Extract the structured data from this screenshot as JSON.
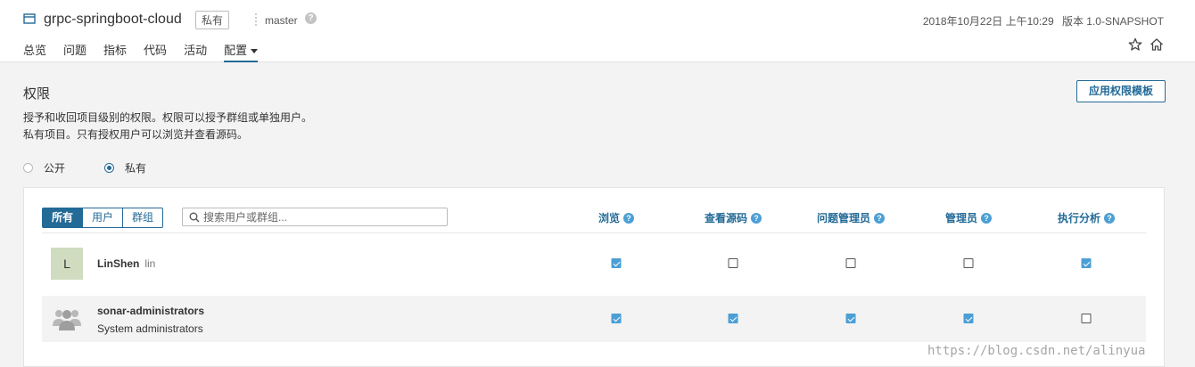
{
  "header": {
    "project_name": "grpc-springboot-cloud",
    "visibility_badge": "私有",
    "branch": "master",
    "date": "2018年10月22日 上午10:29",
    "version": "版本 1.0-SNAPSHOT"
  },
  "nav": {
    "items": [
      "总览",
      "问题",
      "指标",
      "代码",
      "活动",
      "配置"
    ],
    "active": "配置"
  },
  "page": {
    "title": "权限",
    "desc1": "授予和收回项目级别的权限。权限可以授予群组或单独用户。",
    "desc2": "私有项目。只有授权用户可以浏览并查看源码。",
    "apply_template_label": "应用权限模板",
    "visibility": {
      "public_label": "公开",
      "private_label": "私有",
      "selected": "私有"
    }
  },
  "filter": {
    "tabs": [
      "所有",
      "用户",
      "群组"
    ],
    "selected": "所有",
    "search_placeholder": "搜索用户或群组..."
  },
  "columns": [
    "浏览",
    "查看源码",
    "问题管理员",
    "管理员",
    "执行分析"
  ],
  "rows": [
    {
      "avatar": "L",
      "name": "LinShen",
      "login": "lin",
      "description": "",
      "permissions": [
        true,
        false,
        false,
        false,
        true
      ]
    },
    {
      "avatar": "group-icon",
      "name": "sonar-administrators",
      "login": "",
      "description": "System administrators",
      "permissions": [
        true,
        true,
        true,
        true,
        false
      ]
    }
  ],
  "watermark": "https://blog.csdn.net/alinyua",
  "colors": {
    "accent": "#236a97",
    "checkbox": "#4b9fd5",
    "avatar_bg": "#cfdcc0"
  }
}
